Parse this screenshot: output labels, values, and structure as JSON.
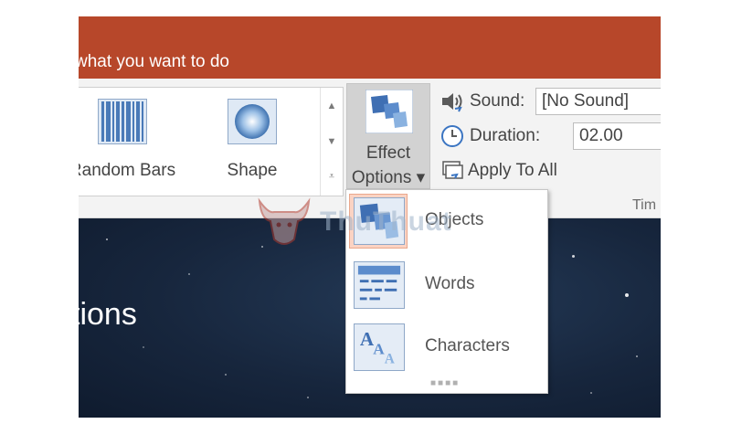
{
  "ribbon": {
    "tell_me": "what you want to do",
    "gallery": {
      "items": [
        {
          "label": "Random Bars",
          "icon": "random-bars-icon"
        },
        {
          "label": "Shape",
          "icon": "shape-circle-icon"
        }
      ]
    },
    "effect_options": {
      "line1": "Effect",
      "line2": "Options ▾"
    },
    "timing": {
      "sound_label": "Sound:",
      "sound_value": "[No Sound]",
      "duration_label": "Duration:",
      "duration_value": "02.00",
      "apply_label": "Apply To All",
      "group_label": "Tim"
    }
  },
  "dropdown": {
    "items": [
      {
        "label": "Objects",
        "icon": "objects-icon",
        "selected": true
      },
      {
        "label": "Words",
        "icon": "words-icon",
        "selected": false
      },
      {
        "label": "Characters",
        "icon": "characters-icon",
        "selected": false
      }
    ]
  },
  "slide": {
    "title_fragment": "tions"
  },
  "watermark": {
    "text": "ThuThuat"
  },
  "colors": {
    "titlebar": "#b7472a",
    "ribbon": "#f3f3f3",
    "slide": "#17263d",
    "selected_highlight": "#fbd3c3"
  }
}
